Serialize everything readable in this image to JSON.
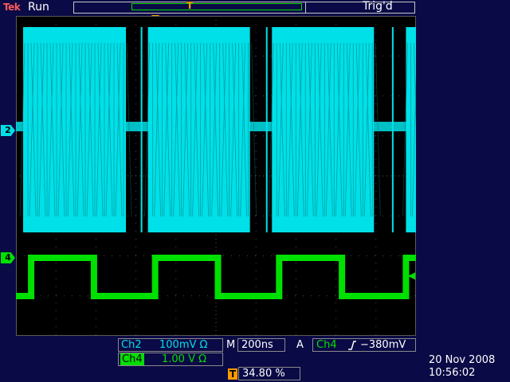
{
  "status": {
    "brand": "Tek",
    "acq_state": "Run",
    "trigger_state": "Trig'd"
  },
  "channels": {
    "ch2_marker": "2",
    "ch4_marker": "4",
    "ch2_color": "#00e0e8",
    "ch4_color": "#00e000"
  },
  "readout": {
    "ch2_label": "Ch2",
    "ch2_scale": "100mV Ω",
    "ch4_label": "Ch4",
    "ch4_scale": "1.00 V Ω",
    "timebase_label": "M",
    "timebase_value": "200ns",
    "trigger_mode": "A",
    "trigger_source": "Ch4",
    "trigger_slope_icon": "rising-edge-icon",
    "trigger_level": "−380mV",
    "trigger_position_icon": "T",
    "trigger_position": "34.80 %"
  },
  "datetime": {
    "date": "20 Nov 2008",
    "time": "10:56:02"
  },
  "waveform": {
    "bursts": [
      {
        "start_div": 0.18,
        "end_div": 2.75
      },
      {
        "start_div": 3.3,
        "end_div": 5.85
      },
      {
        "start_div": 6.4,
        "end_div": 8.95
      },
      {
        "start_div": 9.75,
        "end_div": 10.0
      }
    ],
    "square_high_segments": [
      {
        "start_div": 0.38,
        "end_div": 1.95
      },
      {
        "start_div": 3.48,
        "end_div": 5.05
      },
      {
        "start_div": 6.58,
        "end_div": 8.15
      },
      {
        "start_div": 9.75,
        "end_div": 10.0
      }
    ]
  }
}
